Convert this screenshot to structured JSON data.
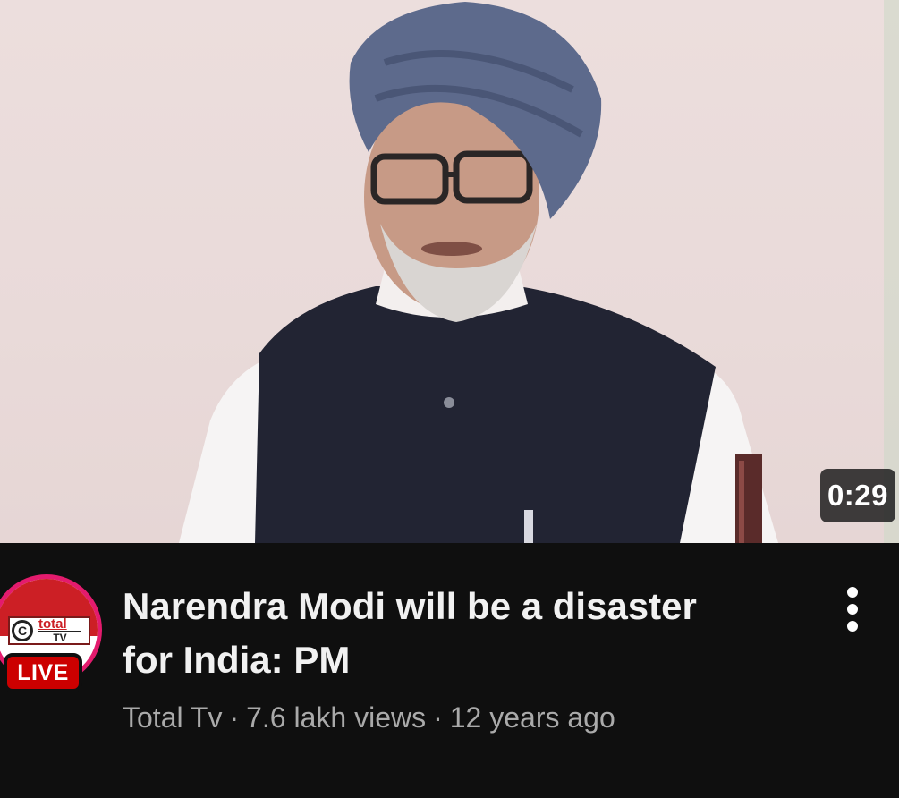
{
  "video": {
    "duration": "0:29",
    "title_line1": "Narendra Modi will be a disaster",
    "title_line2": "for India: PM",
    "channel": "Total Tv",
    "views": "7.6 lakh views",
    "age": "12 years ago",
    "separator": "·"
  },
  "avatar": {
    "logo_text": "total",
    "logo_sub": "TV",
    "logo_mark": "C",
    "live_label": "LIVE"
  },
  "colors": {
    "background": "#0f0f0f",
    "title": "#f1f1f1",
    "meta": "#aaaaaa",
    "live_badge": "#cc0000",
    "avatar_ring": "#e31b6d"
  },
  "icons": {
    "more": "more-vertical-icon"
  }
}
